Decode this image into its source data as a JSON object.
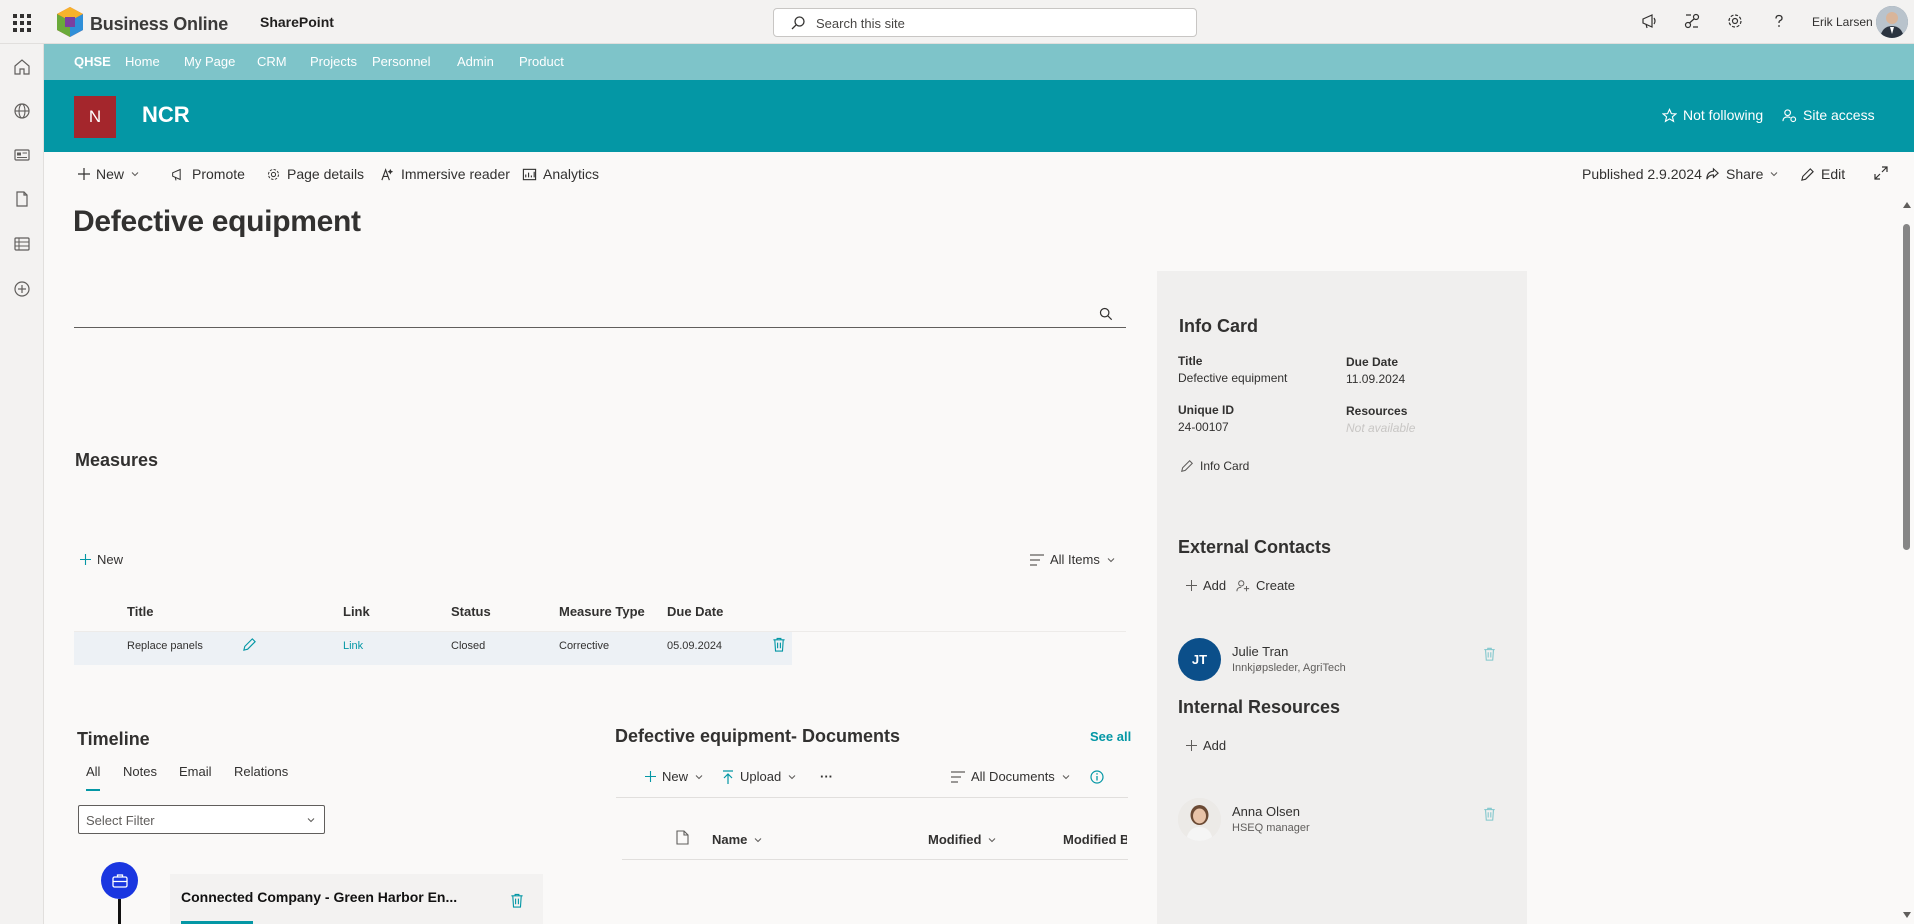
{
  "suitebar": {
    "brand": "Business Online",
    "app": "SharePoint",
    "search_placeholder": "Search this site",
    "user": "Erik Larsen"
  },
  "hubnav": {
    "name": "QHSE",
    "items": [
      "Home",
      "My Page",
      "CRM",
      "Projects",
      "Personnel",
      "Admin",
      "Product"
    ]
  },
  "site": {
    "logo_letter": "N",
    "title": "NCR",
    "follow": "Not following",
    "access": "Site access",
    "logo_color": "#a4262c",
    "header_color": "#0497a5",
    "nav_color": "#7ec4c9"
  },
  "commandbar": {
    "new": "New",
    "promote": "Promote",
    "page_details": "Page details",
    "immersive_reader": "Immersive reader",
    "analytics": "Analytics",
    "published": "Published 2.9.2024",
    "share": "Share",
    "edit": "Edit"
  },
  "page": {
    "title": "Defective equipment"
  },
  "measures": {
    "title": "Measures",
    "new": "New",
    "view": "All Items",
    "columns": [
      "Title",
      "Link",
      "Status",
      "Measure Type",
      "Due Date"
    ],
    "rows": [
      {
        "title": "Replace panels",
        "link": "Link",
        "status": "Closed",
        "type": "Corrective",
        "due": "05.09.2024"
      }
    ]
  },
  "timeline": {
    "title": "Timeline",
    "tabs": [
      "All",
      "Notes",
      "Email",
      "Relations"
    ],
    "filter_placeholder": "Select Filter",
    "card_title": "Connected Company - Green Harbor En..."
  },
  "documents": {
    "title": "Defective equipment- Documents",
    "see_all": "See all",
    "new": "New",
    "upload": "Upload",
    "more": "···",
    "view": "All Documents",
    "columns": [
      "Name",
      "Modified",
      "Modified By"
    ]
  },
  "infocard": {
    "title": "Info Card",
    "fields": {
      "title_label": "Title",
      "title_value": "Defective equipment",
      "due_label": "Due Date",
      "due_value": "11.09.2024",
      "uid_label": "Unique ID",
      "uid_value": "24-00107",
      "res_label": "Resources",
      "res_value": "Not available"
    },
    "edit_label": "Info Card"
  },
  "external": {
    "title": "External Contacts",
    "add": "Add",
    "create": "Create",
    "contacts": [
      {
        "initials": "JT",
        "name": "Julie Tran",
        "role": "Innkjøpsleder, AgriTech"
      }
    ]
  },
  "internal": {
    "title": "Internal Resources",
    "add": "Add",
    "people": [
      {
        "name": "Anna Olsen",
        "role": "HSEQ manager"
      }
    ]
  }
}
